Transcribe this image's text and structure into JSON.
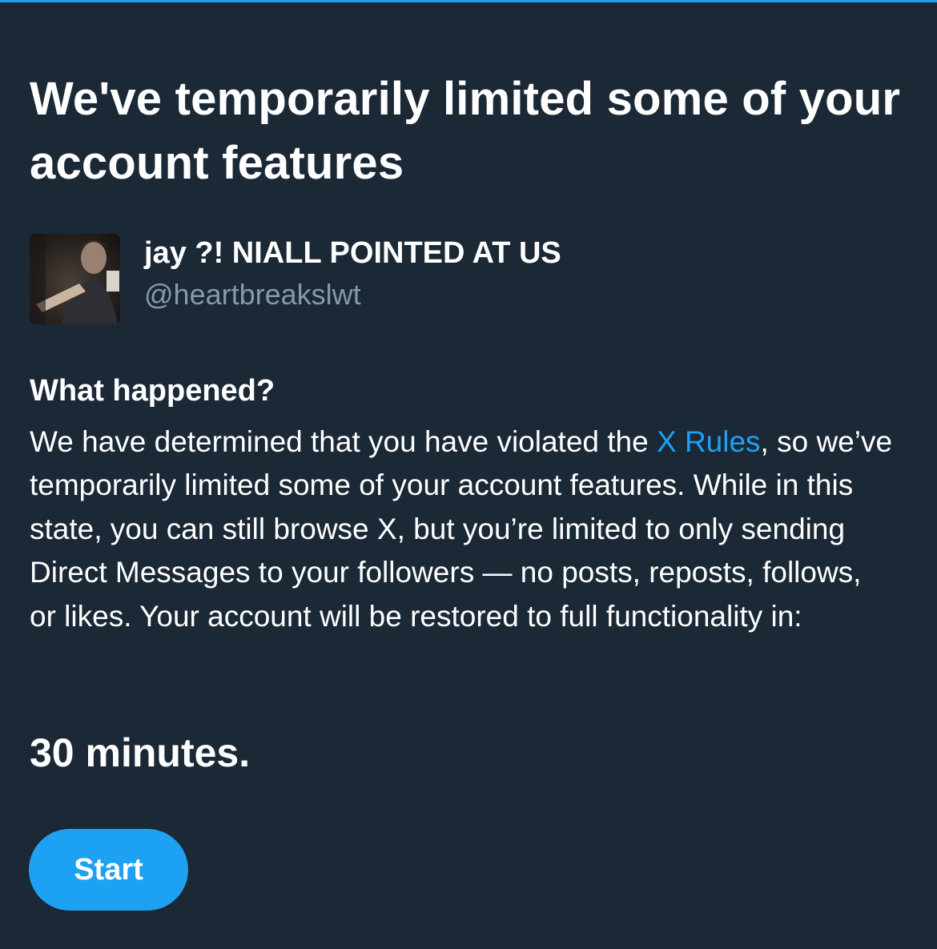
{
  "title": "We've temporarily limited some of your account features",
  "account": {
    "display_name": "jay ?! NIALL POINTED AT US",
    "handle": "@heartbreakslwt",
    "avatar": "profile-photo"
  },
  "section": {
    "heading": "What happened?",
    "body_before_link": "We have determined that you have violated the ",
    "link_text": "X Rules",
    "body_after_link": ", so we’ve temporarily limited some of your account features. While in this state, you can still browse X, but you’re limited to only sending Direct Messages to your followers — no posts, reposts, follows, or likes. Your account will be restored to full functionality in:"
  },
  "duration": "30 minutes.",
  "start_button": {
    "label": "Start"
  },
  "colors": {
    "background": "#1b2836",
    "accent": "#1da1f2",
    "secondary_text": "#8899a6",
    "primary_text": "#ffffff"
  }
}
